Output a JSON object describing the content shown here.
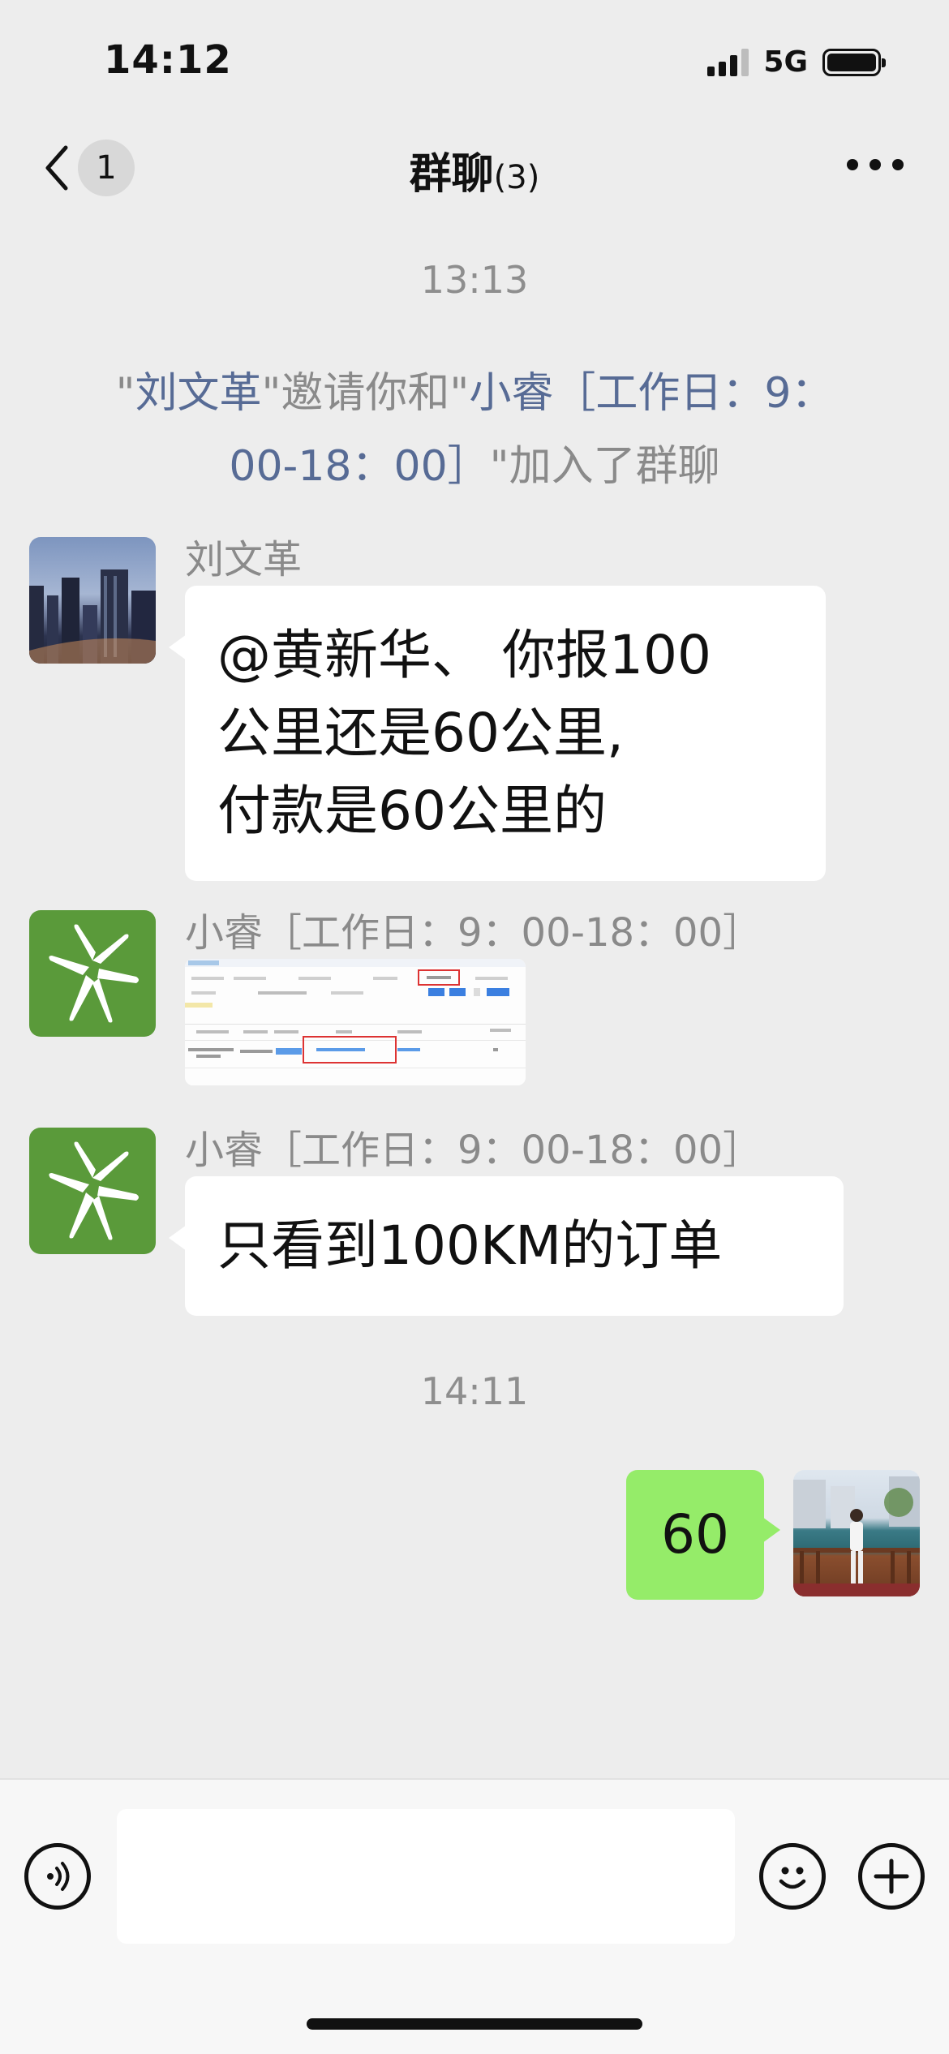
{
  "status_bar": {
    "time": "14:12",
    "network": "5G"
  },
  "nav": {
    "back_badge": "1",
    "title": "群聊",
    "member_count": "(3)"
  },
  "system": {
    "time_1": "13:13",
    "invite_quote_open": "\"",
    "inviter": "刘文革",
    "invite_mid": "\"邀请你和\"",
    "invitee": "小睿［工作日：9：00-18：00］",
    "invite_end": "\"加入了群聊",
    "time_2": "14:11"
  },
  "messages": [
    {
      "sender": "刘文革",
      "text_lines": [
        "@黄新华、 你报100",
        "公里还是60公里,",
        "付款是60公里的"
      ]
    },
    {
      "sender": "小睿［工作日：9：00-18：00］",
      "type": "image"
    },
    {
      "sender": "小睿［工作日：9：00-18：00］",
      "text": "只看到100KM的订单"
    },
    {
      "sender": "me",
      "text": "60"
    }
  ],
  "icons": {
    "back": "chevron-left-icon",
    "more": "ellipsis-icon",
    "voice": "voice-icon",
    "emoji": "emoji-icon",
    "plus": "plus-icon"
  },
  "colors": {
    "my_bubble": "#95ec69",
    "name_link": "#576b95"
  }
}
